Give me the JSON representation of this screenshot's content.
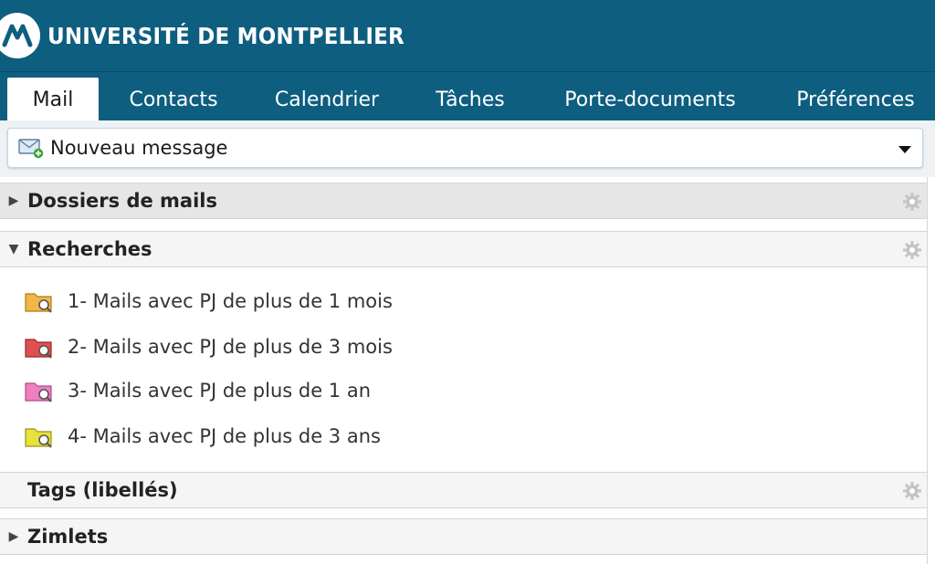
{
  "header": {
    "brand": "UNIVERSITÉ DE MONTPELLIER",
    "bg_color": "#0e5e80",
    "logo_icon": "university-logo-icon"
  },
  "tabs": [
    {
      "label": "Mail",
      "active": true
    },
    {
      "label": "Contacts",
      "active": false
    },
    {
      "label": "Calendrier",
      "active": false
    },
    {
      "label": "Tâches",
      "active": false
    },
    {
      "label": "Porte-documents",
      "active": false
    },
    {
      "label": "Préférences",
      "active": false
    }
  ],
  "toolbar": {
    "new_message_label": "Nouveau message",
    "icon": "envelope-plus-icon"
  },
  "sections": {
    "folders": {
      "title": "Dossiers de mails",
      "expanded": false
    },
    "searches": {
      "title": "Recherches",
      "expanded": true,
      "items": [
        {
          "label": "1- Mails avec PJ de plus de 1 mois",
          "color": "#f2b64a"
        },
        {
          "label": "2- Mails avec PJ de plus de 3 mois",
          "color": "#e05050"
        },
        {
          "label": "3- Mails avec PJ de plus de 1 an",
          "color": "#ee7fc0"
        },
        {
          "label": "4- Mails avec PJ de plus de 3 ans",
          "color": "#e8e23a"
        }
      ]
    },
    "tags": {
      "title": "Tags (libellés)"
    },
    "zimlets": {
      "title": "Zimlets",
      "expanded": false
    }
  }
}
